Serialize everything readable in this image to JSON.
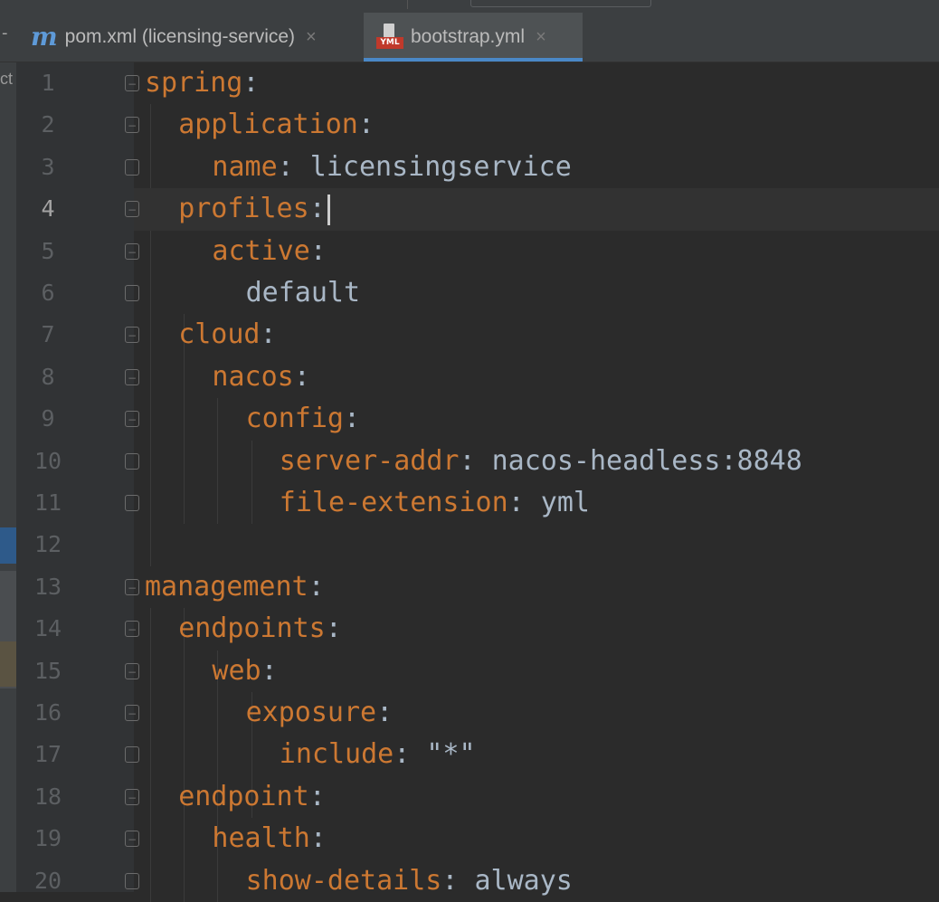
{
  "tabs": [
    {
      "label": "pom.xml (licensing-service)",
      "icon": "maven-icon",
      "active": false
    },
    {
      "label": "bootstrap.yml",
      "icon": "yml-file-icon",
      "icon_text": "YML",
      "active": true
    }
  ],
  "left_strip_label": "ct",
  "current_line": 4,
  "lines": [
    {
      "n": "1",
      "indent": 0,
      "key": "spring",
      "colon": ":",
      "value": ""
    },
    {
      "n": "2",
      "indent": 1,
      "key": "application",
      "colon": ":",
      "value": ""
    },
    {
      "n": "3",
      "indent": 2,
      "key": "name",
      "colon": ":",
      "value": " licensingservice"
    },
    {
      "n": "4",
      "indent": 1,
      "key": "profiles",
      "colon": ":",
      "value": ""
    },
    {
      "n": "5",
      "indent": 2,
      "key": "active",
      "colon": ":",
      "value": ""
    },
    {
      "n": "6",
      "indent": 3,
      "key": "",
      "colon": "",
      "value": "default"
    },
    {
      "n": "7",
      "indent": 1,
      "key": "cloud",
      "colon": ":",
      "value": ""
    },
    {
      "n": "8",
      "indent": 2,
      "key": "nacos",
      "colon": ":",
      "value": ""
    },
    {
      "n": "9",
      "indent": 3,
      "key": "config",
      "colon": ":",
      "value": ""
    },
    {
      "n": "10",
      "indent": 4,
      "key": "server-addr",
      "colon": ":",
      "value": " nacos-headless:8848"
    },
    {
      "n": "11",
      "indent": 4,
      "key": "file-extension",
      "colon": ":",
      "value": " yml"
    },
    {
      "n": "12",
      "indent": 0,
      "key": "",
      "colon": "",
      "value": ""
    },
    {
      "n": "13",
      "indent": 0,
      "key": "management",
      "colon": ":",
      "value": ""
    },
    {
      "n": "14",
      "indent": 1,
      "key": "endpoints",
      "colon": ":",
      "value": ""
    },
    {
      "n": "15",
      "indent": 2,
      "key": "web",
      "colon": ":",
      "value": ""
    },
    {
      "n": "16",
      "indent": 3,
      "key": "exposure",
      "colon": ":",
      "value": ""
    },
    {
      "n": "17",
      "indent": 4,
      "key": "include",
      "colon": ":",
      "value": " \"*\""
    },
    {
      "n": "18",
      "indent": 1,
      "key": "endpoint",
      "colon": ":",
      "value": ""
    },
    {
      "n": "19",
      "indent": 2,
      "key": "health",
      "colon": ":",
      "value": ""
    },
    {
      "n": "20",
      "indent": 3,
      "key": "show-details",
      "colon": ":",
      "value": " always"
    }
  ]
}
